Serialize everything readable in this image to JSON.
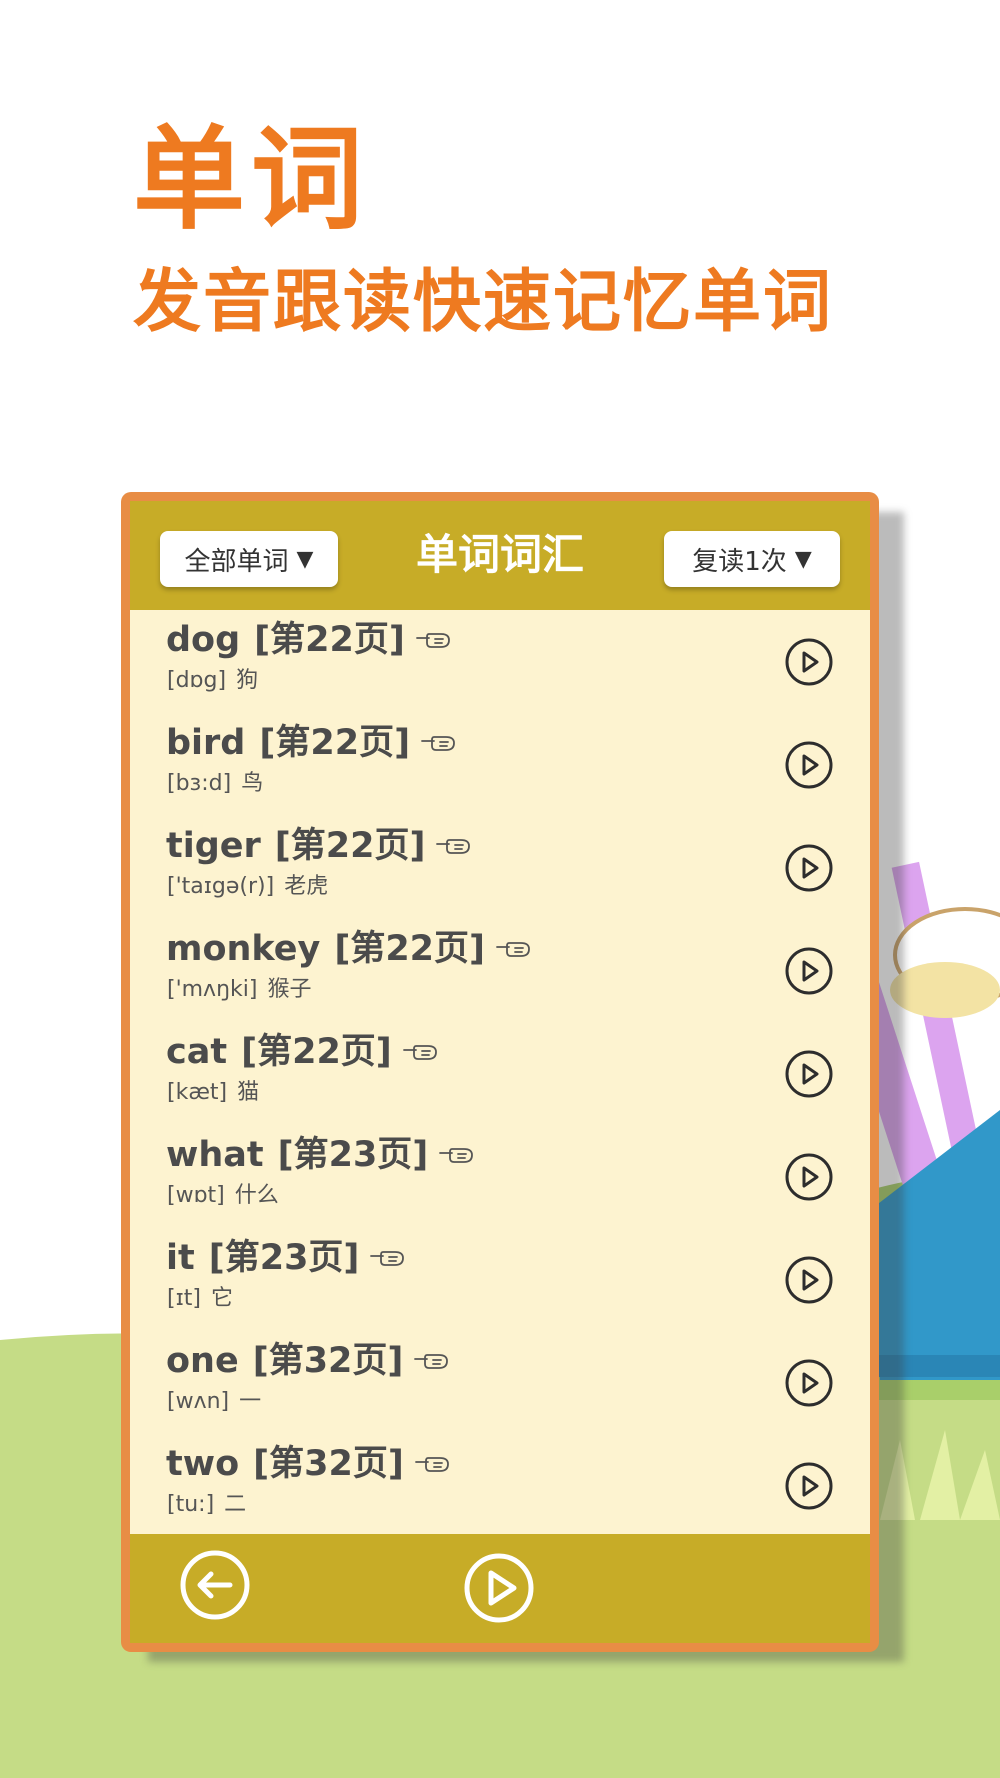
{
  "promo": {
    "title": "单词",
    "subtitle": "发音跟读快速记忆单词"
  },
  "colors": {
    "accent": "#ee7a20",
    "card_border": "#e88d45",
    "header_bar": "#c7ac27",
    "list_bg": "#fdf3d0"
  },
  "header": {
    "filter_label": "全部单词",
    "title": "单词词汇",
    "repeat_label": "复读1次"
  },
  "words": [
    {
      "word": "dog",
      "page": "[第22页]",
      "phonetic": "[dɒg]",
      "meaning": "狗"
    },
    {
      "word": "bird",
      "page": "[第22页]",
      "phonetic": "[bɜ:d]",
      "meaning": "鸟"
    },
    {
      "word": "tiger",
      "page": "[第22页]",
      "phonetic": "['taɪgə(r)]",
      "meaning": "老虎"
    },
    {
      "word": "monkey",
      "page": "[第22页]",
      "phonetic": "['mʌŋki]",
      "meaning": "猴子"
    },
    {
      "word": "cat",
      "page": "[第22页]",
      "phonetic": "[kæt]",
      "meaning": "猫"
    },
    {
      "word": "what",
      "page": "[第23页]",
      "phonetic": "[wɒt]",
      "meaning": "什么"
    },
    {
      "word": "it",
      "page": "[第23页]",
      "phonetic": "[ɪt]",
      "meaning": "它"
    },
    {
      "word": "one",
      "page": "[第32页]",
      "phonetic": "[wʌn]",
      "meaning": "一"
    },
    {
      "word": "two",
      "page": "[第32页]",
      "phonetic": "[tu:]",
      "meaning": "二"
    }
  ],
  "icons": {
    "dropdown": "caret-down-icon",
    "word_hint": "pointing-hand-icon",
    "row_action": "play-circle-icon",
    "footer_left": "back-arrow-circle-icon",
    "footer_center": "play-circle-icon"
  }
}
